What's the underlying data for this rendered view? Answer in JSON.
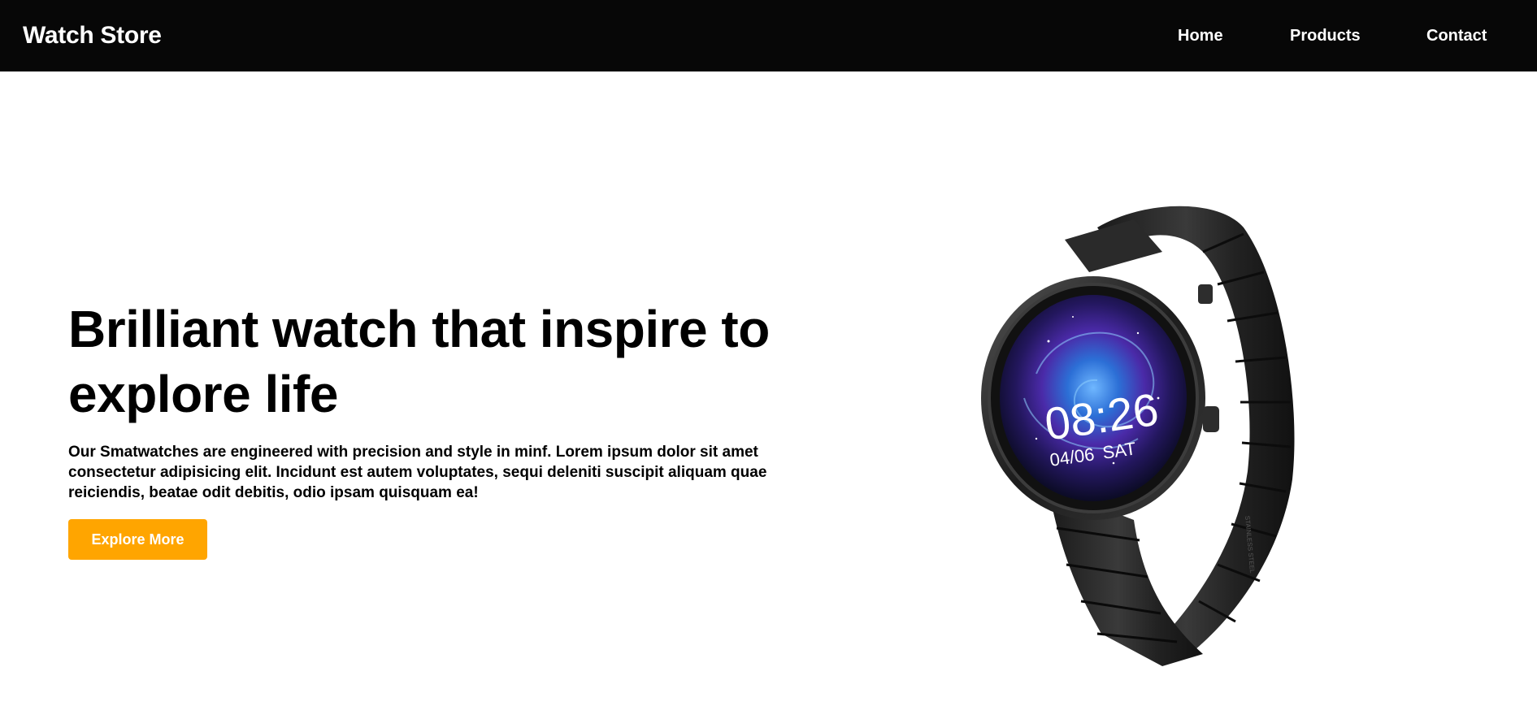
{
  "header": {
    "brand": "Watch Store",
    "nav": [
      {
        "label": "Home"
      },
      {
        "label": "Products"
      },
      {
        "label": "Contact"
      }
    ]
  },
  "hero": {
    "title": "Brilliant watch that inspire to explore life",
    "description": "Our Smatwatches are engineered with precision and style in minf. Lorem ipsum dolor sit amet consectetur adipisicing elit. Incidunt est autem voluptates, sequi deleniti suscipit aliquam quae reiciendis, beatae odit debitis, odio ipsam quisquam ea!",
    "cta_label": "Explore More"
  },
  "watch_image": {
    "time": "08:26",
    "date": "04/06",
    "day": "SAT",
    "band_engraving": "STAINLESS STEEL"
  },
  "colors": {
    "navbar_bg": "#070707",
    "accent": "#ffa500",
    "text": "#000000",
    "background": "#ffffff"
  }
}
